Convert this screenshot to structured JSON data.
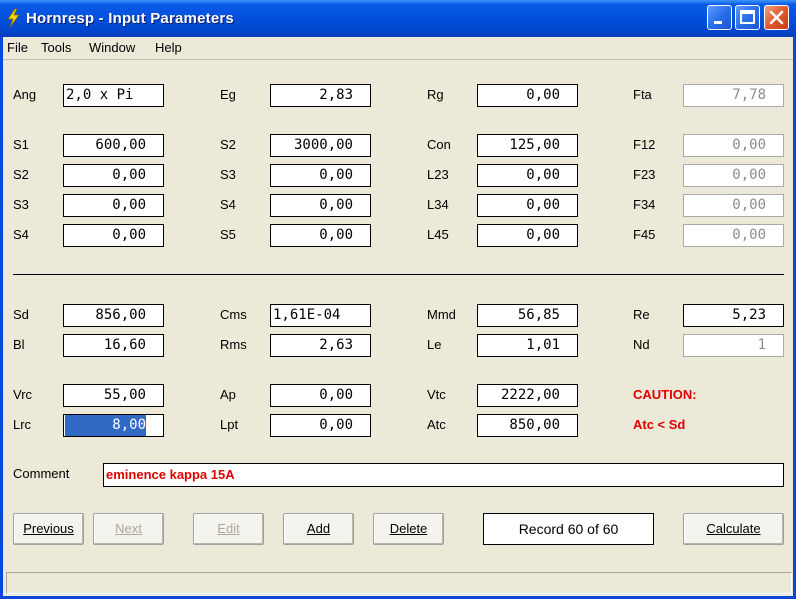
{
  "window": {
    "title": "Hornresp - Input Parameters"
  },
  "menu": [
    "File",
    "Tools",
    "Window",
    "Help"
  ],
  "rows": [
    [
      {
        "label": "Ang",
        "value": "2,0 x Pi",
        "kind": "left"
      },
      {
        "label": "Eg",
        "value": "2,83"
      },
      {
        "label": "Rg",
        "value": "0,00"
      },
      {
        "label": "Fta",
        "value": "7,78",
        "kind": "ro"
      }
    ],
    [
      {
        "label": "S1",
        "value": "600,00"
      },
      {
        "label": "S2",
        "value": "3000,00"
      },
      {
        "label": "Con",
        "value": "125,00"
      },
      {
        "label": "F12",
        "value": "0,00",
        "kind": "ro"
      }
    ],
    [
      {
        "label": "S2",
        "value": "0,00"
      },
      {
        "label": "S3",
        "value": "0,00"
      },
      {
        "label": "L23",
        "value": "0,00"
      },
      {
        "label": "F23",
        "value": "0,00",
        "kind": "ro"
      }
    ],
    [
      {
        "label": "S3",
        "value": "0,00"
      },
      {
        "label": "S4",
        "value": "0,00"
      },
      {
        "label": "L34",
        "value": "0,00"
      },
      {
        "label": "F34",
        "value": "0,00",
        "kind": "ro"
      }
    ],
    [
      {
        "label": "S4",
        "value": "0,00"
      },
      {
        "label": "S5",
        "value": "0,00"
      },
      {
        "label": "L45",
        "value": "0,00"
      },
      {
        "label": "F45",
        "value": "0,00",
        "kind": "ro"
      }
    ],
    [
      {
        "label": "Sd",
        "value": "856,00"
      },
      {
        "label": "Cms",
        "value": "1,61E-04",
        "kind": "left"
      },
      {
        "label": "Mmd",
        "value": "56,85"
      },
      {
        "label": "Re",
        "value": "5,23"
      }
    ],
    [
      {
        "label": "Bl",
        "value": "16,60"
      },
      {
        "label": "Rms",
        "value": "2,63"
      },
      {
        "label": "Le",
        "value": "1,01"
      },
      {
        "label": "Nd",
        "value": "1",
        "kind": "ro"
      }
    ],
    [
      {
        "label": "Vrc",
        "value": "55,00"
      },
      {
        "label": "Ap",
        "value": "0,00"
      },
      {
        "label": "Vtc",
        "value": "2222,00"
      },
      {
        "label": "CAUTION:",
        "kind": "caution"
      }
    ],
    [
      {
        "label": "Lrc",
        "value": "8,00",
        "kind": "sel"
      },
      {
        "label": "Lpt",
        "value": "0,00"
      },
      {
        "label": "Atc",
        "value": "850,00"
      },
      {
        "label": "Atc < Sd",
        "kind": "caution"
      }
    ]
  ],
  "comment": {
    "label": "Comment",
    "value": "eminence kappa 15A"
  },
  "buttons": {
    "previous": "Previous",
    "next": "Next",
    "edit": "Edit",
    "add": "Add",
    "delete": "Delete",
    "calculate": "Calculate"
  },
  "record": "Record 60 of 60",
  "colors": {
    "caution": "#e00000",
    "selection": "#316ac5",
    "titlebar": "#0350dd"
  }
}
